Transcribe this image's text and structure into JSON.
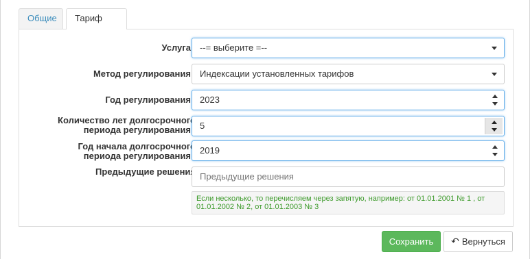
{
  "tabs": [
    {
      "label": "Общие",
      "active": false
    },
    {
      "label": "Тариф",
      "active": true
    }
  ],
  "form": {
    "required_mark": "*",
    "service": {
      "label": "Услуга",
      "value": "--= выберите =--"
    },
    "regulation_method": {
      "label": "Метод регулирования",
      "value": "Индексации установленных тарифов"
    },
    "regulation_year": {
      "label": "Год регулирования",
      "value": "2023"
    },
    "years_count": {
      "label_line1": "Количество лет долгосрочного",
      "label_line2": "периода регулирования",
      "value": "5"
    },
    "start_year": {
      "label_line1": "Год начала долгосрочного",
      "label_line2": "периода регулирования",
      "value": "2019"
    },
    "previous_decisions": {
      "label": "Предыдущие решения",
      "placeholder": "Предыдущие решения",
      "help": "Если несколько, то перечисляем через запятую, например: от 01.01.2001 № 1 , от 01.01.2002 № 2, от 01.01.2003 № 3"
    }
  },
  "actions": {
    "save_label": "Сохранить",
    "back_label": "Вернуться"
  },
  "colors": {
    "link": "#3c8dbc",
    "required": "#cc0000",
    "save_button": "#5cb85c",
    "help_text": "#3c9a2a",
    "focus_border": "#66afe9"
  },
  "icons": {
    "select_caret": "chevron-down-icon",
    "spinner": "spinner-arrows-icon",
    "back": "arrow-left-icon"
  }
}
